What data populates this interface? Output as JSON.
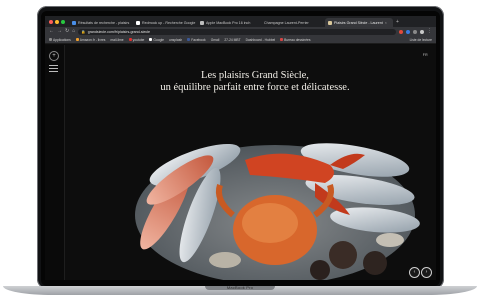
{
  "browser": {
    "tabs": [
      {
        "label": "Résultats de recherche - plaisirs",
        "active": false
      },
      {
        "label": "Redmock up - Recherche Google",
        "active": false
      },
      {
        "label": "Apple MacBook Pro 16 inch",
        "active": false
      },
      {
        "label": "Champagne Laurent-Perrier",
        "active": false
      },
      {
        "label": "Plaisirs Grand Siècle - Laurent",
        "active": true
      }
    ],
    "new_tab": "+",
    "url": "grandsiecle.com/fr/plaisirs-grand-siecle",
    "bookmarks": [
      "Applications",
      "Amazon.fr - livres",
      "mail-lime",
      "youtube",
      "Google",
      "unsplash",
      "Facebook",
      "Gmail",
      "27-24 MBT",
      "Dashboard - Hubbel",
      "Bureau dessinées"
    ],
    "reading_list": "Liste de lecture"
  },
  "page": {
    "lang": "FR",
    "side_button": "+",
    "headline_line1": "Les plaisirs Grand Siècle,",
    "headline_line2": "un équilibre parfait entre force et délicatesse.",
    "controls": [
      "‹",
      "›"
    ]
  },
  "device": {
    "label": "MacBook Pro"
  }
}
